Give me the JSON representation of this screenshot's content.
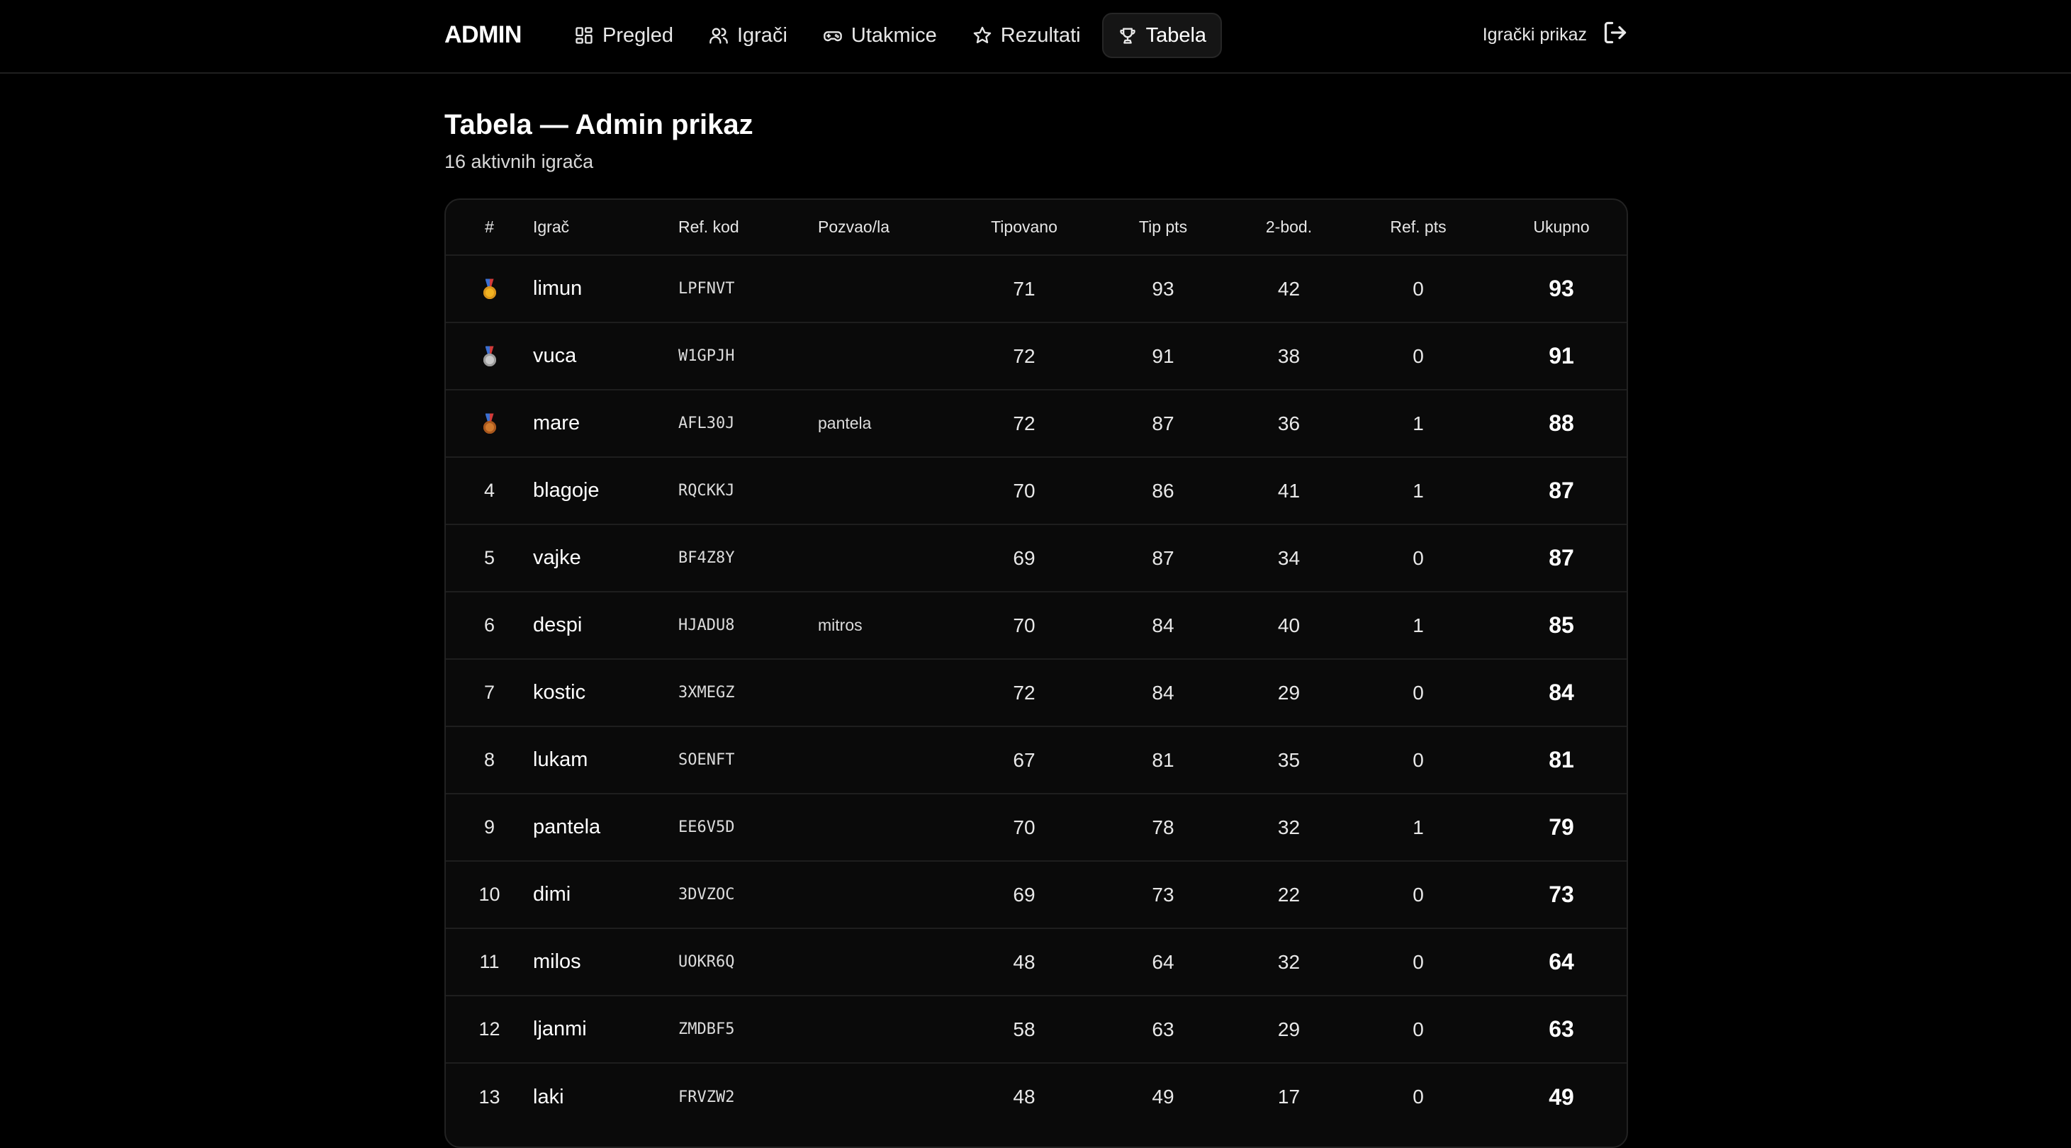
{
  "header": {
    "brand": "ADMIN",
    "nav": [
      {
        "label": "Pregled",
        "icon": "grid-icon"
      },
      {
        "label": "Igrači",
        "icon": "users-icon"
      },
      {
        "label": "Utakmice",
        "icon": "gamepad-icon"
      },
      {
        "label": "Rezultati",
        "icon": "star-icon"
      },
      {
        "label": "Tabela",
        "icon": "trophy-icon",
        "active": true
      }
    ],
    "player_view_label": "Igrački prikaz",
    "logout_icon": "logout-icon"
  },
  "page": {
    "title": "Tabela — Admin prikaz",
    "subtitle": "16 aktivnih igrača"
  },
  "table": {
    "columns": [
      "#",
      "Igrač",
      "Ref. kod",
      "Pozvao/la",
      "Tipovano",
      "Tip pts",
      "2-bod.",
      "Ref. pts",
      "Ukupno"
    ],
    "rows": [
      {
        "rank": "",
        "medal": "gold",
        "name": "limun",
        "ref_code": "LPFNVT",
        "invited_by": "",
        "tipped": "71",
        "tip_pts": "93",
        "two_pt": "42",
        "ref_pts": "0",
        "total": "93"
      },
      {
        "rank": "",
        "medal": "silver",
        "name": "vuca",
        "ref_code": "W1GPJH",
        "invited_by": "",
        "tipped": "72",
        "tip_pts": "91",
        "two_pt": "38",
        "ref_pts": "0",
        "total": "91"
      },
      {
        "rank": "",
        "medal": "bronze",
        "name": "mare",
        "ref_code": "AFL30J",
        "invited_by": "pantela",
        "tipped": "72",
        "tip_pts": "87",
        "two_pt": "36",
        "ref_pts": "1",
        "total": "88"
      },
      {
        "rank": "4",
        "medal": "",
        "name": "blagoje",
        "ref_code": "RQCKKJ",
        "invited_by": "",
        "tipped": "70",
        "tip_pts": "86",
        "two_pt": "41",
        "ref_pts": "1",
        "total": "87"
      },
      {
        "rank": "5",
        "medal": "",
        "name": "vajke",
        "ref_code": "BF4Z8Y",
        "invited_by": "",
        "tipped": "69",
        "tip_pts": "87",
        "two_pt": "34",
        "ref_pts": "0",
        "total": "87"
      },
      {
        "rank": "6",
        "medal": "",
        "name": "despi",
        "ref_code": "HJADU8",
        "invited_by": "mitros",
        "tipped": "70",
        "tip_pts": "84",
        "two_pt": "40",
        "ref_pts": "1",
        "total": "85"
      },
      {
        "rank": "7",
        "medal": "",
        "name": "kostic",
        "ref_code": "3XMEGZ",
        "invited_by": "",
        "tipped": "72",
        "tip_pts": "84",
        "two_pt": "29",
        "ref_pts": "0",
        "total": "84"
      },
      {
        "rank": "8",
        "medal": "",
        "name": "lukam",
        "ref_code": "SOENFT",
        "invited_by": "",
        "tipped": "67",
        "tip_pts": "81",
        "two_pt": "35",
        "ref_pts": "0",
        "total": "81"
      },
      {
        "rank": "9",
        "medal": "",
        "name": "pantela",
        "ref_code": "EE6V5D",
        "invited_by": "",
        "tipped": "70",
        "tip_pts": "78",
        "two_pt": "32",
        "ref_pts": "1",
        "total": "79"
      },
      {
        "rank": "10",
        "medal": "",
        "name": "dimi",
        "ref_code": "3DVZOC",
        "invited_by": "",
        "tipped": "69",
        "tip_pts": "73",
        "two_pt": "22",
        "ref_pts": "0",
        "total": "73"
      },
      {
        "rank": "11",
        "medal": "",
        "name": "milos",
        "ref_code": "UOKR6Q",
        "invited_by": "",
        "tipped": "48",
        "tip_pts": "64",
        "two_pt": "32",
        "ref_pts": "0",
        "total": "64"
      },
      {
        "rank": "12",
        "medal": "",
        "name": "ljanmi",
        "ref_code": "ZMDBF5",
        "invited_by": "",
        "tipped": "58",
        "tip_pts": "63",
        "two_pt": "29",
        "ref_pts": "0",
        "total": "63"
      },
      {
        "rank": "13",
        "medal": "",
        "name": "laki",
        "ref_code": "FRVZW2",
        "invited_by": "",
        "tipped": "48",
        "tip_pts": "49",
        "two_pt": "17",
        "ref_pts": "0",
        "total": "49"
      }
    ]
  },
  "colors": {
    "background": "#000000",
    "table_bg": "#0a0a0a",
    "border": "#222222",
    "active_tab_bg": "#151515"
  }
}
